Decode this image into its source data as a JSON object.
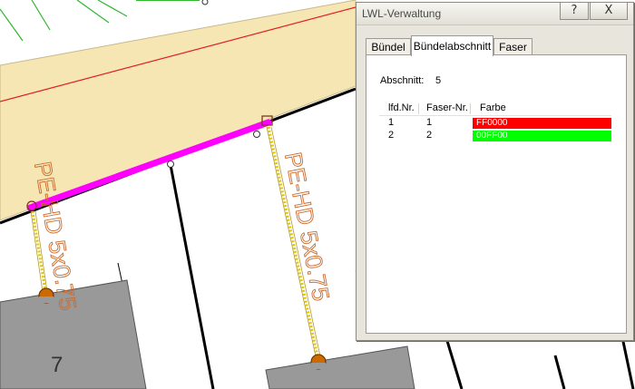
{
  "map": {
    "cable_label_left": "PE-HD 5x0.75",
    "cable_label_right": "PE-HD 5x0.75",
    "parcel_number": "7"
  },
  "dialog": {
    "title": "LWL-Verwaltung",
    "help_button": "?",
    "close_button": "X",
    "tabs": [
      {
        "label": "Bündel"
      },
      {
        "label": "Bündelabschnitt",
        "selected": true
      },
      {
        "label": "Faser"
      }
    ],
    "section_label": "Abschnitt:",
    "section_value": "5",
    "table": {
      "headers": [
        "lfd.Nr.",
        "Faser-Nr.",
        "Farbe"
      ],
      "rows": [
        {
          "lfd": "1",
          "faser": "1",
          "farbe": "FF0000",
          "color": "#ff0000"
        },
        {
          "lfd": "2",
          "faser": "2",
          "farbe": "00FF00",
          "color": "#00ff00"
        }
      ]
    }
  },
  "colors": {
    "cable_route": "#ff00ff",
    "road_fill": "#f6e6b4",
    "building": "#999999",
    "green_lines": "#2db82d",
    "red_line": "#e02020",
    "cable_label": "#cc6a2a"
  }
}
